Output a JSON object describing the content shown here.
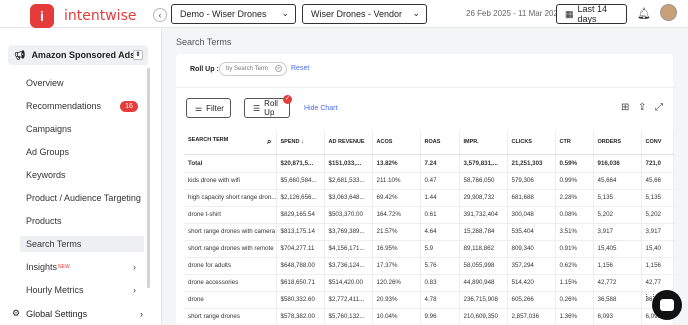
{
  "topbar": {
    "brand": "intentwise",
    "logo_letter": "i",
    "account": "Demo - Wiser Drones",
    "profile": "Wiser Drones - Vendor",
    "date_range": "26 Feb 2025 - 11 Mar 2025",
    "period": "Last 14 days"
  },
  "sidebar": {
    "header": "Amazon Sponsored Ads",
    "items": [
      {
        "label": "Overview"
      },
      {
        "label": "Recommendations",
        "badge": "16"
      },
      {
        "label": "Campaigns"
      },
      {
        "label": "Ad Groups"
      },
      {
        "label": "Keywords"
      },
      {
        "label": "Product / Audience Targeting"
      },
      {
        "label": "Products"
      },
      {
        "label": "Search Terms"
      },
      {
        "label": "Insights",
        "tag": "NEW"
      },
      {
        "label": "Hourly Metrics"
      }
    ],
    "global_settings": "Global Settings"
  },
  "page": {
    "title": "Search Terms",
    "rollup_label": "Roll Up :",
    "rollup_chip": "by Search Term",
    "reset": "Reset",
    "filter": "Filter",
    "rollup_btn": "Roll Up",
    "hide_chart": "Hide Chart"
  },
  "table": {
    "columns": [
      "SEARCH TERM",
      "SPEND",
      "AD REVENUE",
      "ACOS",
      "ROAS",
      "IMPR.",
      "CLICKS",
      "CTR",
      "ORDERS",
      "CONV"
    ],
    "total": [
      "Total",
      "$20,871,5...",
      "$151,033,...",
      "13.82%",
      "7.24",
      "3,579,831,...",
      "21,251,303",
      "0.59%",
      "916,036",
      "721,0"
    ],
    "rows": [
      [
        "kids drone with wifi",
        "$5,660,584...",
        "$2,681,533...",
        "211.10%",
        "0.47",
        "58,766,050",
        "579,306",
        "0.99%",
        "45,664",
        "45,66"
      ],
      [
        "high capacity short range dron...",
        "$2,126,656...",
        "$3,063,648...",
        "69.42%",
        "1.44",
        "29,908,732",
        "681,688",
        "2.28%",
        "5,135",
        "5,135"
      ],
      [
        "drone t-shirt",
        "$829,165.54",
        "$503,370.00",
        "164.72%",
        "0.61",
        "391,732,404",
        "300,048",
        "0.08%",
        "5,202",
        "5,202"
      ],
      [
        "short range drones with camera",
        "$813,175.14",
        "$3,769,389...",
        "21.57%",
        "4.64",
        "15,268,784",
        "535,404",
        "3.51%",
        "3,917",
        "3,917"
      ],
      [
        "short range drones with remote",
        "$704,277.11",
        "$4,156,171...",
        "16.95%",
        "5.9",
        "89,118,862",
        "809,340",
        "0.91%",
        "15,405",
        "15,40"
      ],
      [
        "drone for adults",
        "$648,788.00",
        "$3,736,124...",
        "17.37%",
        "5.76",
        "58,055,998",
        "357,294",
        "0.62%",
        "1,156",
        "1,156"
      ],
      [
        "drone accessories",
        "$618,650.71",
        "$514,420.00",
        "120.26%",
        "0.83",
        "44,890,948",
        "514,420",
        "1.15%",
        "42,772",
        "42,77"
      ],
      [
        "drone",
        "$580,332.60",
        "$2,772,411...",
        "20.93%",
        "4.78",
        "236,715,908",
        "605,266",
        "0.26%",
        "36,588",
        "36,58"
      ],
      [
        "short range drones",
        "$578,382.00",
        "$5,760,132...",
        "10.04%",
        "9.96",
        "210,609,350",
        "2,857,036",
        "1.36%",
        "6,093",
        "6,093"
      ]
    ]
  }
}
